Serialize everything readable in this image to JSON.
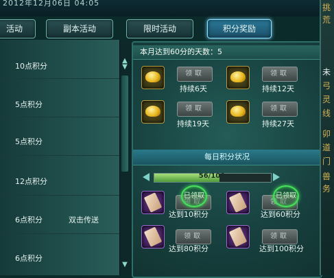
{
  "datetime": "2012年12月06日  04:05",
  "tabs": [
    {
      "label": "活动"
    },
    {
      "label": "副本活动"
    },
    {
      "label": "限时活动"
    },
    {
      "label": "积分奖励"
    }
  ],
  "left_list": {
    "items": [
      {
        "label": "10点积分",
        "action": ""
      },
      {
        "label": "5点积分",
        "action": ""
      },
      {
        "label": "5点积分",
        "action": ""
      },
      {
        "label": "12点积分",
        "action": ""
      },
      {
        "label": "6点积分",
        "action": "双击传送"
      },
      {
        "label": "6点积分",
        "action": ""
      }
    ]
  },
  "monthly": {
    "header": "本月达到60分的天数：5",
    "rewards": [
      {
        "duration": "持续6天",
        "claim": "领取"
      },
      {
        "duration": "持续12天",
        "claim": "领取"
      },
      {
        "duration": "持续19天",
        "claim": "领取"
      },
      {
        "duration": "持续27天",
        "claim": "领取"
      }
    ]
  },
  "daily": {
    "header": "每日积分状况",
    "progress_text": "56/100",
    "progress_fraction": 0.56,
    "rewards": [
      {
        "condition": "达到10积分",
        "claim": "领取",
        "badge": "已领取",
        "claimed": true
      },
      {
        "condition": "达到60积分",
        "claim": "领取",
        "badge": "已领取",
        "claimed": true
      },
      {
        "condition": "达到80积分",
        "claim": "领取",
        "badge": "",
        "claimed": false
      },
      {
        "condition": "达到100积分",
        "claim": "领取",
        "badge": "",
        "claimed": false
      }
    ]
  },
  "far_right_glyphs": [
    "挑",
    "荒",
    "未",
    "弓",
    "灵",
    "线",
    "卯",
    "道",
    "门",
    "兽",
    "务"
  ],
  "colors": {
    "active_tab": "#2b7a9a",
    "progress": "#4f9a3b",
    "claimed_ring": "#46e05a"
  }
}
